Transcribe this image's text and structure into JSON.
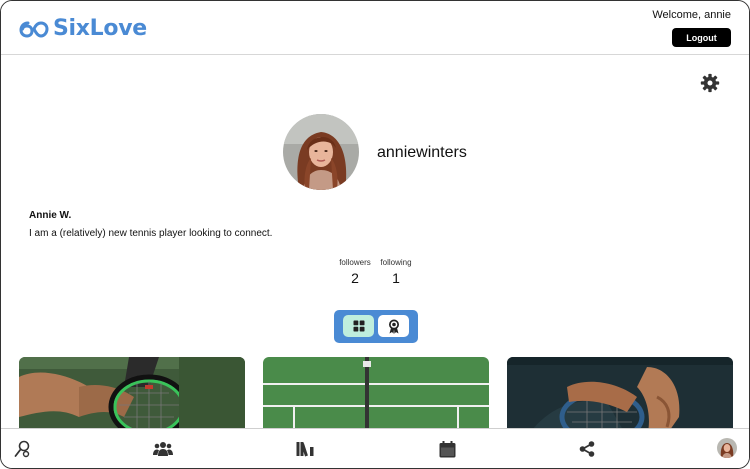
{
  "header": {
    "brand": "SixLove",
    "welcome": "Welcome, annie",
    "logout_label": "Logout"
  },
  "profile": {
    "username": "anniewinters",
    "full_name": "Annie W.",
    "bio": "I am a (relatively) new tennis player looking to connect.",
    "stats": [
      {
        "label": "followers",
        "value": "2"
      },
      {
        "label": "following",
        "value": "1"
      }
    ]
  },
  "view_toggle": {
    "options": [
      "grid-icon",
      "award-icon"
    ],
    "selected": "grid-icon"
  },
  "posts": [
    {
      "icon": "tennis-player-racket-photo"
    },
    {
      "icon": "tennis-court-net-photo"
    },
    {
      "icon": "tennis-racket-hands-photo"
    }
  ],
  "bottom_nav": {
    "items": [
      "search-person-icon",
      "people-icon",
      "library-icon",
      "calendar-icon",
      "share-icon",
      "profile-avatar"
    ]
  },
  "colors": {
    "accent": "#4a8ad4",
    "toggle_selected": "#bfeedd",
    "button_dark": "#000000"
  }
}
